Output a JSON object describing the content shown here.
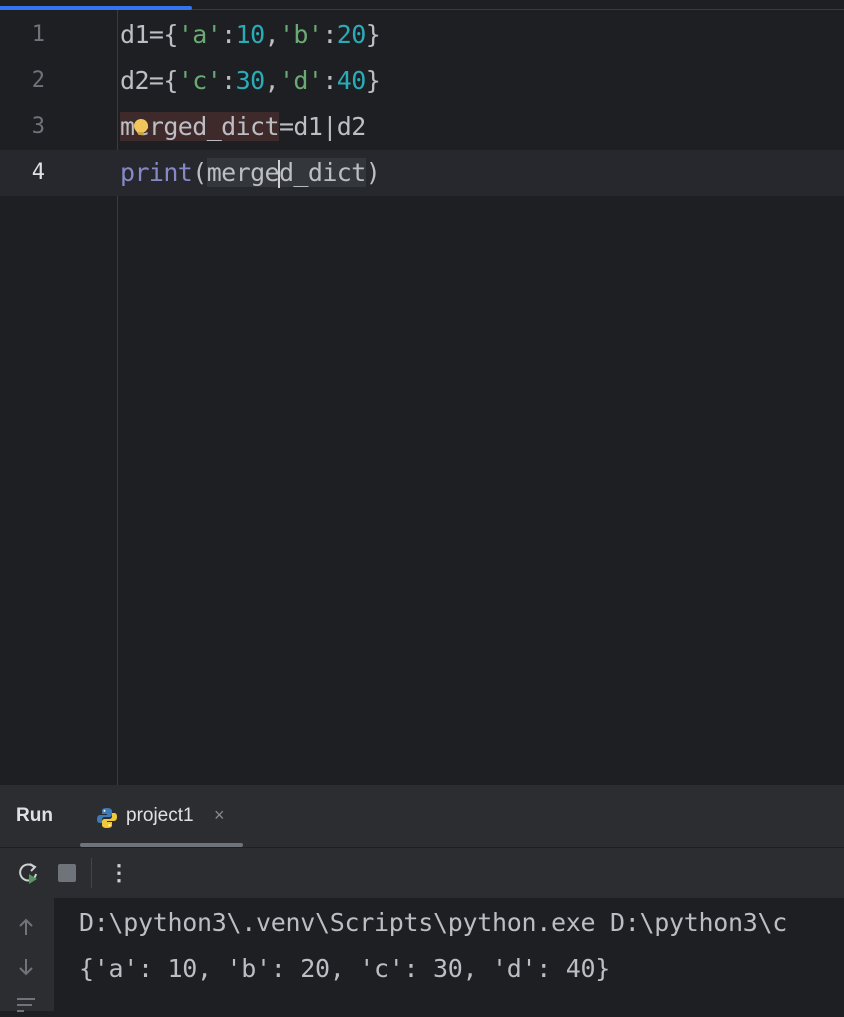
{
  "editor": {
    "line_numbers": [
      "1",
      "2",
      "3",
      "4"
    ],
    "lines": {
      "l1": {
        "p1": "d1={",
        "s1": "'a'",
        "p2": ":",
        "n1": "10",
        "p3": ",",
        "s2": "'b'",
        "p4": ":",
        "n2": "20",
        "p5": "}"
      },
      "l2": {
        "p1": "d2={",
        "s1": "'c'",
        "p2": ":",
        "n1": "30",
        "p3": ",",
        "s2": "'d'",
        "p4": ":",
        "n2": "40",
        "p5": "}"
      },
      "l3": {
        "var": "merged_dict",
        "rest": "=d1|d2"
      },
      "l4": {
        "kw": "print",
        "open": "(",
        "var_a": "merge",
        "var_b": "d_dict",
        "close": ")"
      }
    },
    "current_line": "4"
  },
  "run_panel": {
    "title": "Run",
    "tab_label": "project1",
    "tab_close": "×",
    "more_icon": "⋮",
    "console_lines": [
      "D:\\python3\\.venv\\Scripts\\python.exe D:\\python3\\c",
      "{'a': 10, 'b': 20, 'c': 30, 'd': 40}"
    ]
  },
  "colors": {
    "background": "#1e1f22",
    "string": "#6aab73",
    "number": "#2aacb8",
    "builtin": "#8888c6",
    "accent": "#3574f0"
  }
}
